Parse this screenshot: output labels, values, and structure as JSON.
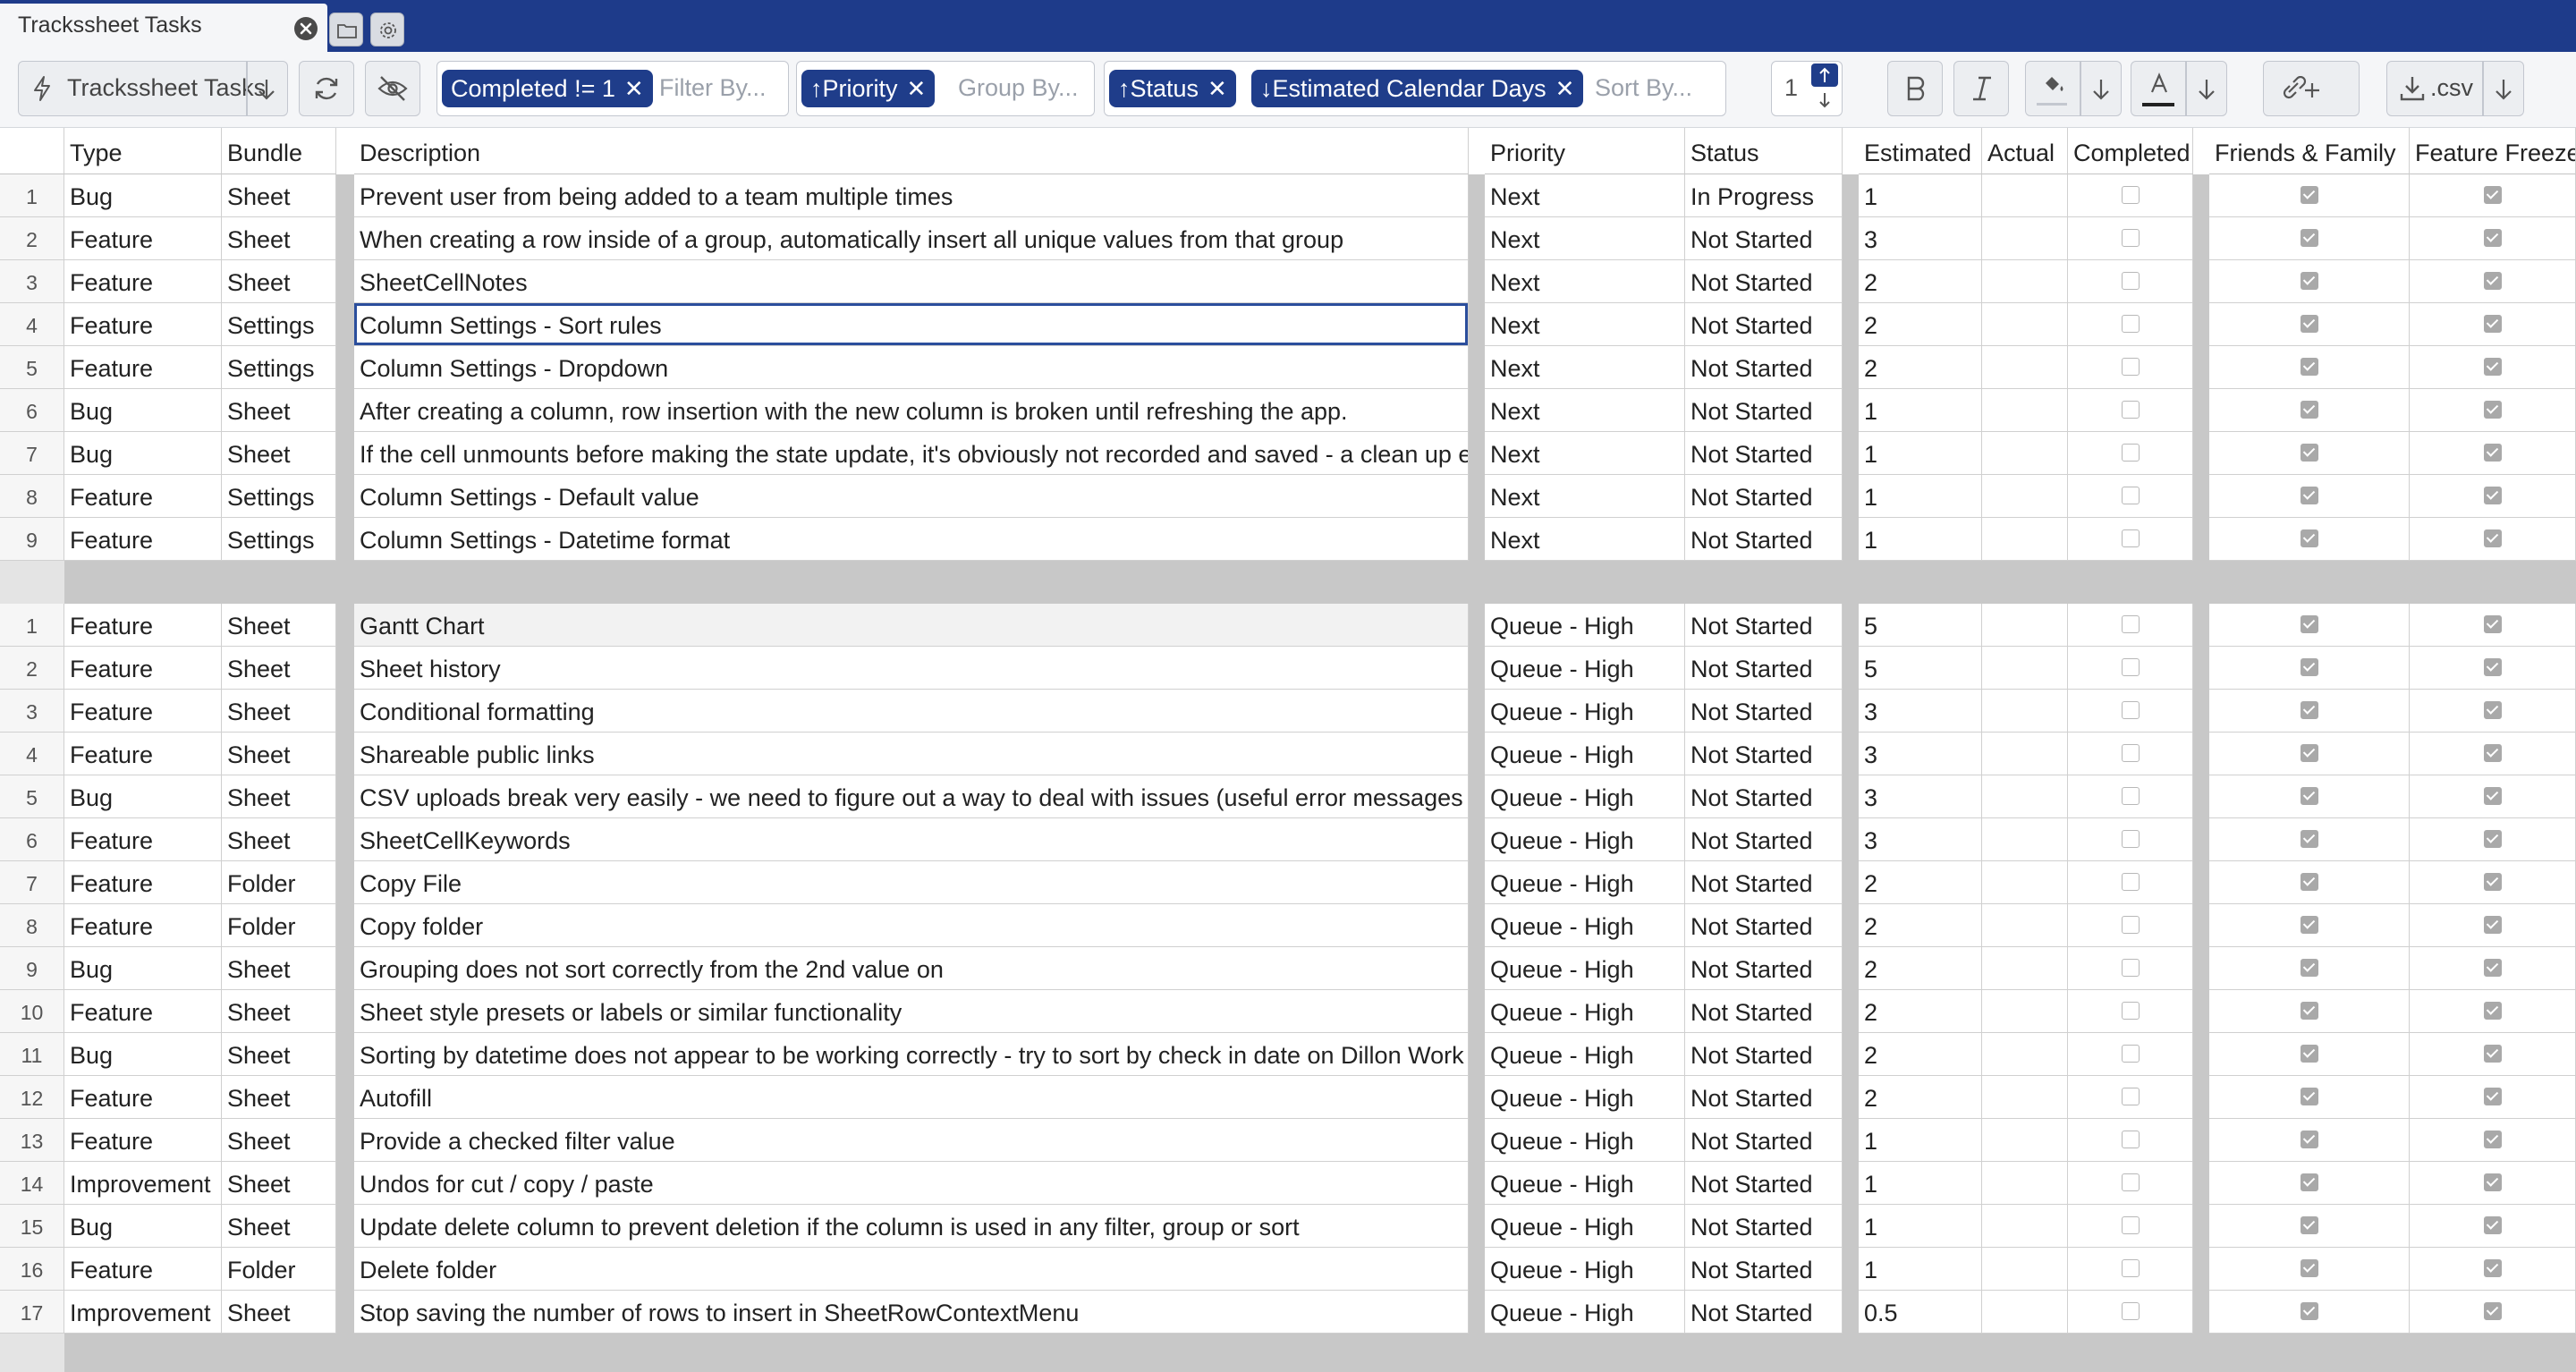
{
  "tab": {
    "title": "Trackssheet Tasks"
  },
  "toolbar": {
    "sheet_button_label": "Trackssheet Tasks",
    "filter_chip": "Completed != 1",
    "filter_placeholder": "Filter By...",
    "group_chip": "Priority",
    "group_placeholder": "Group By...",
    "sort_chips": [
      "Status",
      "Estimated Calendar Days"
    ],
    "sort_placeholder": "Sort By...",
    "rows_to_insert": "1",
    "export_label": ".csv",
    "colors": {
      "accent": "#1f3d8a",
      "topbar": "#1e3b8a"
    }
  },
  "columns": [
    "Type",
    "Bundle",
    "Description",
    "Priority",
    "Status",
    "Estimated",
    "Actual",
    "Completed",
    "Friends & Family",
    "Feature Freeze"
  ],
  "groups": [
    {
      "rows": [
        {
          "n": "1",
          "type": "Bug",
          "bundle": "Sheet",
          "desc": "Prevent user from being added to a team multiple times",
          "priority": "Next",
          "status": "In Progress",
          "est": "1",
          "actual": "",
          "completed": false,
          "ff": true,
          "freeze": true
        },
        {
          "n": "2",
          "type": "Feature",
          "bundle": "Sheet",
          "desc": "When creating a row inside of a group, automatically insert all unique values from that group",
          "priority": "Next",
          "status": "Not Started",
          "est": "3",
          "actual": "",
          "completed": false,
          "ff": true,
          "freeze": true
        },
        {
          "n": "3",
          "type": "Feature",
          "bundle": "Sheet",
          "desc": "SheetCellNotes",
          "priority": "Next",
          "status": "Not Started",
          "est": "2",
          "actual": "",
          "completed": false,
          "ff": true,
          "freeze": true
        },
        {
          "n": "4",
          "type": "Feature",
          "bundle": "Settings",
          "desc": "Column Settings - Sort rules",
          "priority": "Next",
          "status": "Not Started",
          "est": "2",
          "actual": "",
          "completed": false,
          "ff": true,
          "freeze": true
        },
        {
          "n": "5",
          "type": "Feature",
          "bundle": "Settings",
          "desc": "Column Settings - Dropdown",
          "priority": "Next",
          "status": "Not Started",
          "est": "2",
          "actual": "",
          "completed": false,
          "ff": true,
          "freeze": true
        },
        {
          "n": "6",
          "type": "Bug",
          "bundle": "Sheet",
          "desc": "After creating a column, row insertion with the new column is broken until refreshing the app.",
          "priority": "Next",
          "status": "Not Started",
          "est": "1",
          "actual": "",
          "completed": false,
          "ff": true,
          "freeze": true
        },
        {
          "n": "7",
          "type": "Bug",
          "bundle": "Sheet",
          "desc": "If the cell unmounts before making the state update, it's obviously not recorded and saved - a clean up e",
          "priority": "Next",
          "status": "Not Started",
          "est": "1",
          "actual": "",
          "completed": false,
          "ff": true,
          "freeze": true
        },
        {
          "n": "8",
          "type": "Feature",
          "bundle": "Settings",
          "desc": "Column Settings - Default value",
          "priority": "Next",
          "status": "Not Started",
          "est": "1",
          "actual": "",
          "completed": false,
          "ff": true,
          "freeze": true
        },
        {
          "n": "9",
          "type": "Feature",
          "bundle": "Settings",
          "desc": "Column Settings - Datetime format",
          "priority": "Next",
          "status": "Not Started",
          "est": "1",
          "actual": "",
          "completed": false,
          "ff": true,
          "freeze": true
        }
      ]
    },
    {
      "rows": [
        {
          "n": "1",
          "type": "Feature",
          "bundle": "Sheet",
          "desc": "Gantt Chart",
          "priority": "Queue - High",
          "status": "Not Started",
          "est": "5",
          "actual": "",
          "completed": false,
          "ff": true,
          "freeze": true
        },
        {
          "n": "2",
          "type": "Feature",
          "bundle": "Sheet",
          "desc": "Sheet history",
          "priority": "Queue - High",
          "status": "Not Started",
          "est": "5",
          "actual": "",
          "completed": false,
          "ff": true,
          "freeze": true
        },
        {
          "n": "3",
          "type": "Feature",
          "bundle": "Sheet",
          "desc": "Conditional formatting",
          "priority": "Queue - High",
          "status": "Not Started",
          "est": "3",
          "actual": "",
          "completed": false,
          "ff": true,
          "freeze": true
        },
        {
          "n": "4",
          "type": "Feature",
          "bundle": "Sheet",
          "desc": "Shareable public links",
          "priority": "Queue - High",
          "status": "Not Started",
          "est": "3",
          "actual": "",
          "completed": false,
          "ff": true,
          "freeze": true
        },
        {
          "n": "5",
          "type": "Bug",
          "bundle": "Sheet",
          "desc": "CSV uploads break very easily - we need to figure out a way to deal with issues (useful error messages ar",
          "priority": "Queue - High",
          "status": "Not Started",
          "est": "3",
          "actual": "",
          "completed": false,
          "ff": true,
          "freeze": true
        },
        {
          "n": "6",
          "type": "Feature",
          "bundle": "Sheet",
          "desc": "SheetCellKeywords",
          "priority": "Queue - High",
          "status": "Not Started",
          "est": "3",
          "actual": "",
          "completed": false,
          "ff": true,
          "freeze": true
        },
        {
          "n": "7",
          "type": "Feature",
          "bundle": "Folder",
          "desc": "Copy File",
          "priority": "Queue - High",
          "status": "Not Started",
          "est": "2",
          "actual": "",
          "completed": false,
          "ff": true,
          "freeze": true
        },
        {
          "n": "8",
          "type": "Feature",
          "bundle": "Folder",
          "desc": "Copy folder",
          "priority": "Queue - High",
          "status": "Not Started",
          "est": "2",
          "actual": "",
          "completed": false,
          "ff": true,
          "freeze": true
        },
        {
          "n": "9",
          "type": "Bug",
          "bundle": "Sheet",
          "desc": "Grouping does not sort correctly from the 2nd value on",
          "priority": "Queue - High",
          "status": "Not Started",
          "est": "2",
          "actual": "",
          "completed": false,
          "ff": true,
          "freeze": true
        },
        {
          "n": "10",
          "type": "Feature",
          "bundle": "Sheet",
          "desc": "Sheet style presets or labels or similar functionality",
          "priority": "Queue - High",
          "status": "Not Started",
          "est": "2",
          "actual": "",
          "completed": false,
          "ff": true,
          "freeze": true
        },
        {
          "n": "11",
          "type": "Bug",
          "bundle": "Sheet",
          "desc": "Sorting by datetime does not appear to be working correctly - try to sort by check in date on Dillon Work",
          "priority": "Queue - High",
          "status": "Not Started",
          "est": "2",
          "actual": "",
          "completed": false,
          "ff": true,
          "freeze": true
        },
        {
          "n": "12",
          "type": "Feature",
          "bundle": "Sheet",
          "desc": "Autofill",
          "priority": "Queue - High",
          "status": "Not Started",
          "est": "2",
          "actual": "",
          "completed": false,
          "ff": true,
          "freeze": true
        },
        {
          "n": "13",
          "type": "Feature",
          "bundle": "Sheet",
          "desc": "Provide a checked filter value",
          "priority": "Queue - High",
          "status": "Not Started",
          "est": "1",
          "actual": "",
          "completed": false,
          "ff": true,
          "freeze": true
        },
        {
          "n": "14",
          "type": "Improvement",
          "bundle": "Sheet",
          "desc": "Undos for cut / copy / paste",
          "priority": "Queue - High",
          "status": "Not Started",
          "est": "1",
          "actual": "",
          "completed": false,
          "ff": true,
          "freeze": true
        },
        {
          "n": "15",
          "type": "Bug",
          "bundle": "Sheet",
          "desc": "Update delete column to prevent deletion if the column is used in any filter, group or sort",
          "priority": "Queue - High",
          "status": "Not Started",
          "est": "1",
          "actual": "",
          "completed": false,
          "ff": true,
          "freeze": true
        },
        {
          "n": "16",
          "type": "Feature",
          "bundle": "Folder",
          "desc": "Delete folder",
          "priority": "Queue - High",
          "status": "Not Started",
          "est": "1",
          "actual": "",
          "completed": false,
          "ff": true,
          "freeze": true
        },
        {
          "n": "17",
          "type": "Improvement",
          "bundle": "Sheet",
          "desc": "Stop saving the number of rows to insert in SheetRowContextMenu",
          "priority": "Queue - High",
          "status": "Not Started",
          "est": "0.5",
          "actual": "",
          "completed": false,
          "ff": true,
          "freeze": true
        }
      ]
    }
  ],
  "selected_cell": {
    "group": 0,
    "row": 3,
    "column": "Description"
  },
  "hovered_cell": {
    "group": 1,
    "row": 0,
    "column": "Description"
  }
}
